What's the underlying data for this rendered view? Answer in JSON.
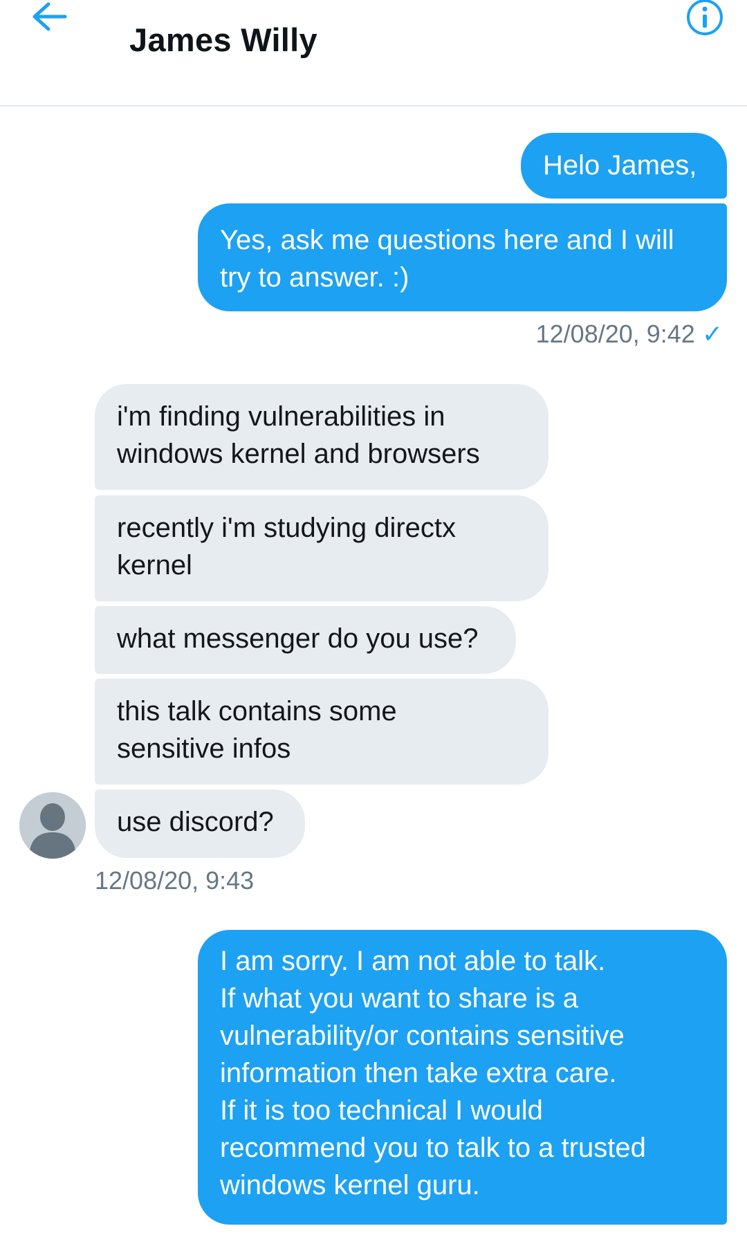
{
  "header": {
    "title": "James Willy",
    "back_icon": "arrow-left-icon",
    "info_icon": "info-circle-icon"
  },
  "colors": {
    "accent": "#1da1f2",
    "incoming_bubble": "#e6ecf0",
    "timestamp": "#657786"
  },
  "messages": {
    "out1": {
      "lines": [
        "Helo James,"
      ]
    },
    "out2": {
      "lines": [
        "Yes, ask me questions here and I will",
        "try to answer. :)"
      ]
    },
    "out_group1_timestamp": "12/08/20, 9:42",
    "in1": {
      "lines": [
        "i'm finding vulnerabilities in",
        "windows kernel and browsers"
      ]
    },
    "in2": {
      "lines": [
        "recently i'm studying directx",
        "kernel"
      ]
    },
    "in3": {
      "lines": [
        "what messenger do you use?"
      ]
    },
    "in4": {
      "lines": [
        "this talk contains some",
        "sensitive infos"
      ]
    },
    "in5": {
      "lines": [
        "use discord?"
      ]
    },
    "in_group_timestamp": "12/08/20, 9:43",
    "out3": {
      "lines": [
        "I am sorry. I am not able to talk.",
        "If what you want to share is a",
        "vulnerability/or contains sensitive",
        "information then take extra care.",
        "If it is too technical I would",
        "recommend you to talk to a trusted",
        "windows kernel guru."
      ]
    },
    "read_icon": "checkmark-icon"
  }
}
